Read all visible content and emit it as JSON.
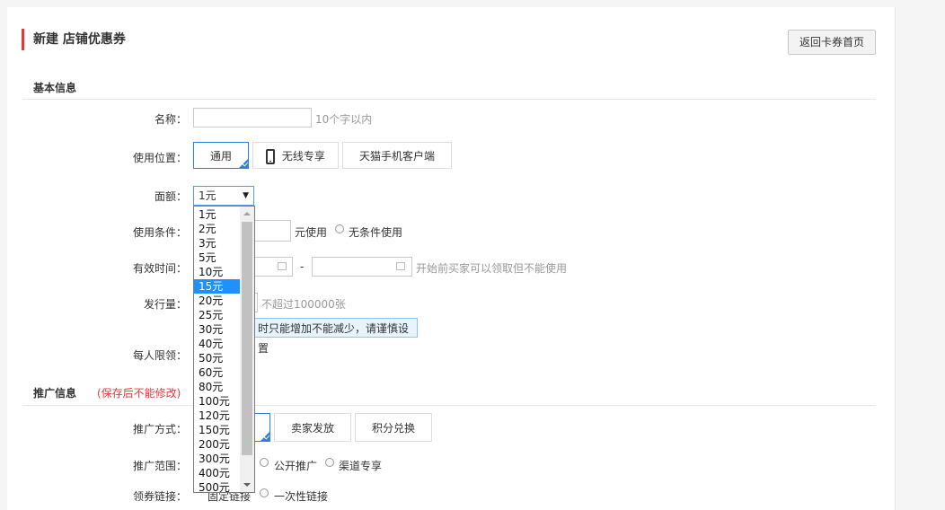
{
  "header": {
    "title": "新建 店铺优惠券",
    "back_label": "返回卡券首页"
  },
  "basic": {
    "section_title": "基本信息",
    "name_label": "名称：",
    "name_hint": "10个字以内",
    "position_label": "使用位置：",
    "position_options": [
      "通用",
      "无线专享",
      "天猫手机客户端"
    ],
    "amount_label": "面额：",
    "amount_selected": "1元",
    "amount_options": [
      "1元",
      "2元",
      "3元",
      "5元",
      "10元",
      "15元",
      "20元",
      "25元",
      "30元",
      "40元",
      "50元",
      "60元",
      "80元",
      "100元",
      "120元",
      "150元",
      "200元",
      "300元",
      "400元",
      "500元"
    ],
    "amount_highlighted": "15元",
    "condition_label": "使用条件：",
    "condition_unit": "元使用",
    "condition_none": "无条件使用",
    "time_label": "有效时间：",
    "time_sep": "-",
    "time_hint": "开始前买家可以领取但不能使用",
    "issue_label": "发行量：",
    "issue_hint": "不超过100000张",
    "issue_notice": "时只能增加不能减少，请谨慎设置",
    "limit_label": "每人限领："
  },
  "promo": {
    "section_title": "推广信息",
    "section_note": "(保存后不能修改)",
    "method_label": "推广方式：",
    "method_options": [
      "卖家发放",
      "积分兑换"
    ],
    "scope_label": "推广范围：",
    "scope_options": [
      "公开推广",
      "渠道专享"
    ],
    "link_label": "领券链接：",
    "link_options": [
      "固定链接",
      "一次性链接"
    ]
  },
  "colors": {
    "accent": "#e4393c",
    "selected_blue": "#2e7de1",
    "dropdown_highlight": "#1e90ff"
  }
}
